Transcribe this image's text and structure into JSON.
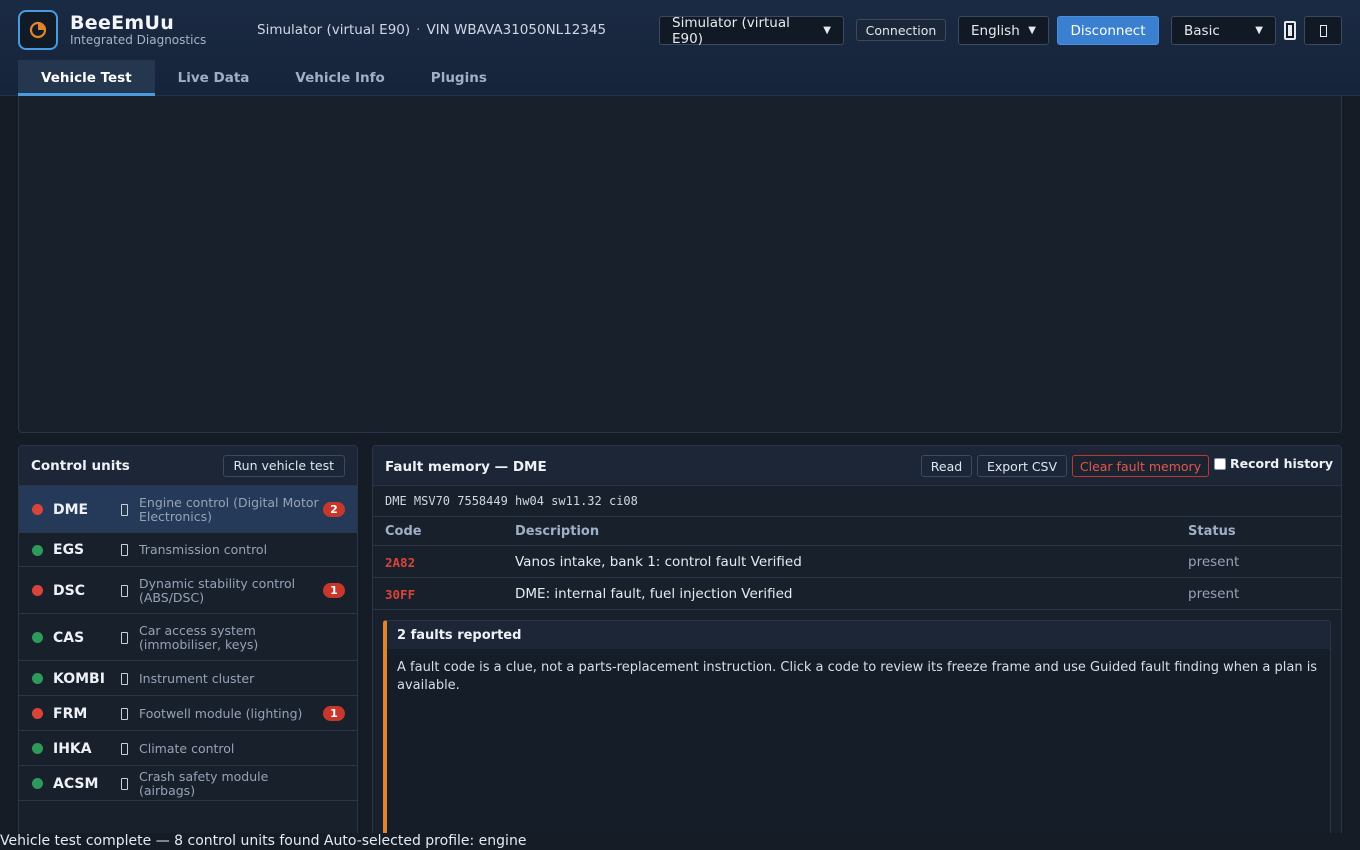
{
  "app": {
    "name": "BeeEmUu",
    "subtitle": "Integrated Diagnostics",
    "connection_label": "Simulator (virtual E90)",
    "vin_label": "VIN WBAVA31050NL12345",
    "separator": "·"
  },
  "toolbar": {
    "interface_select": "Simulator (virtual E90)",
    "connection_button": "Connection",
    "language_select": "English",
    "disconnect_button": "Disconnect",
    "mode_select": "Basic",
    "theme_icon": "phone-icon",
    "menu_icon": "unknown-glyph-icon"
  },
  "tabs": [
    {
      "label": "Vehicle Test",
      "active": true
    },
    {
      "label": "Live Data",
      "active": false
    },
    {
      "label": "Vehicle Info",
      "active": false
    },
    {
      "label": "Plugins",
      "active": false
    }
  ],
  "control_units": {
    "title": "Control units",
    "run_button": "Run vehicle test",
    "items": [
      {
        "name": "DME",
        "desc": "Engine control (Digital Motor Electronics)",
        "status": "red",
        "faults": "2",
        "selected": true
      },
      {
        "name": "EGS",
        "desc": "Transmission control",
        "status": "green",
        "faults": "",
        "selected": false
      },
      {
        "name": "DSC",
        "desc": "Dynamic stability control (ABS/DSC)",
        "status": "red",
        "faults": "1",
        "selected": false
      },
      {
        "name": "CAS",
        "desc": "Car access system (immobiliser, keys)",
        "status": "green",
        "faults": "",
        "selected": false
      },
      {
        "name": "KOMBI",
        "desc": "Instrument cluster",
        "status": "green",
        "faults": "",
        "selected": false
      },
      {
        "name": "FRM",
        "desc": "Footwell module (lighting)",
        "status": "red",
        "faults": "1",
        "selected": false
      },
      {
        "name": "IHKA",
        "desc": "Climate control",
        "status": "green",
        "faults": "",
        "selected": false
      },
      {
        "name": "ACSM",
        "desc": "Crash safety module (airbags)",
        "status": "green",
        "faults": "",
        "selected": false
      }
    ]
  },
  "fault_memory": {
    "title": "Fault memory — DME",
    "read_button": "Read",
    "export_button": "Export CSV",
    "clear_button": "Clear fault memory",
    "record_history_label": "Record history",
    "firmware": "DME MSV70 7558449 hw04 sw11.32 ci08",
    "columns": [
      "Code",
      "Description",
      "Status"
    ],
    "rows": [
      {
        "code": "2A82",
        "description": "Vanos intake, bank 1: control fault Verified",
        "status": "present"
      },
      {
        "code": "30FF",
        "description": "DME: internal fault, fuel injection Verified",
        "status": "present"
      }
    ],
    "callout_title": "2 faults reported",
    "callout_body": "A fault code is a clue, not a parts-replacement instruction. Click a code to review its freeze frame and use Guided fault finding when a plan is available."
  },
  "status_bar": "Vehicle test complete — 8 control units found Auto-selected profile: engine",
  "colors": {
    "accent": "#4a9ae0",
    "primary_button": "#3a7fd0",
    "fault_red": "#d9443a",
    "ok_green": "#2e9a5a",
    "warning_orange": "#e0852e"
  }
}
